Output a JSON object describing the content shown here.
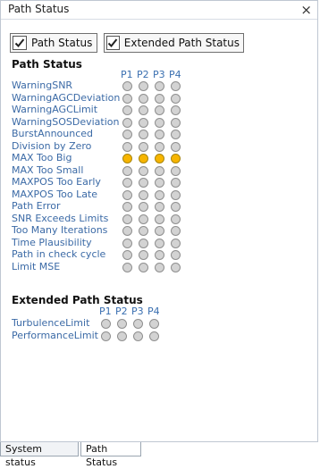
{
  "window": {
    "title": "Path Status",
    "close_glyph": "×"
  },
  "toolbar": {
    "buttons": [
      {
        "label": "Path Status",
        "checked": true
      },
      {
        "label": "Extended Path Status",
        "checked": true
      }
    ]
  },
  "path_status": {
    "heading": "Path Status",
    "columns": [
      "P1",
      "P2",
      "P3",
      "P4"
    ],
    "rows": [
      {
        "label": "WarningSNR",
        "states": [
          0,
          0,
          0,
          0
        ]
      },
      {
        "label": "WarningAGCDeviation",
        "states": [
          0,
          0,
          0,
          0
        ]
      },
      {
        "label": "WarningAGCLimit",
        "states": [
          0,
          0,
          0,
          0
        ]
      },
      {
        "label": "WarningSOSDeviation",
        "states": [
          0,
          0,
          0,
          0
        ]
      },
      {
        "label": "BurstAnnounced",
        "states": [
          0,
          0,
          0,
          0
        ]
      },
      {
        "label": "Division by Zero",
        "states": [
          0,
          0,
          0,
          0
        ]
      },
      {
        "label": "MAX Too Big",
        "states": [
          1,
          1,
          1,
          1
        ]
      },
      {
        "label": "MAX Too Small",
        "states": [
          0,
          0,
          0,
          0
        ]
      },
      {
        "label": "MAXPOS Too Early",
        "states": [
          0,
          0,
          0,
          0
        ]
      },
      {
        "label": "MAXPOS Too Late",
        "states": [
          0,
          0,
          0,
          0
        ]
      },
      {
        "label": "Path Error",
        "states": [
          0,
          0,
          0,
          0
        ]
      },
      {
        "label": "SNR Exceeds Limits",
        "states": [
          0,
          0,
          0,
          0
        ]
      },
      {
        "label": "Too Many Iterations",
        "states": [
          0,
          0,
          0,
          0
        ]
      },
      {
        "label": "Time Plausibility",
        "states": [
          0,
          0,
          0,
          0
        ]
      },
      {
        "label": "Path in check cycle",
        "states": [
          0,
          0,
          0,
          0
        ]
      },
      {
        "label": "Limit MSE",
        "states": [
          0,
          0,
          0,
          0
        ]
      }
    ]
  },
  "extended_path_status": {
    "heading": "Extended Path Status",
    "columns": [
      "P1",
      "P2",
      "P3",
      "P4"
    ],
    "rows": [
      {
        "label": "TurbulenceLimit",
        "states": [
          0,
          0,
          0,
          0
        ]
      },
      {
        "label": "PerformanceLimit",
        "states": [
          0,
          0,
          0,
          0
        ]
      }
    ]
  },
  "tabs": [
    {
      "label": "System status",
      "active": false
    },
    {
      "label": "Path Status",
      "active": true
    }
  ],
  "colors": {
    "indicator_on": "#f7b500",
    "indicator_off": "#d3d3d3",
    "label_text": "#3b6aa6"
  }
}
